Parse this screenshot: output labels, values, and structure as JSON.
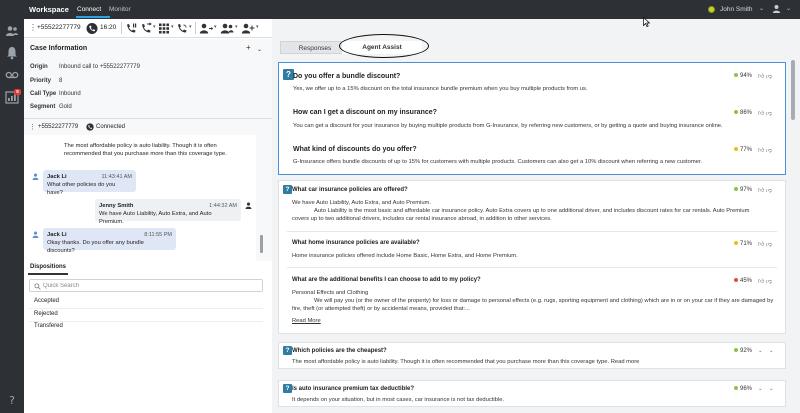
{
  "topbar": {
    "title": "Workspace",
    "tabs": [
      "Connect",
      "Monitor"
    ],
    "user": "John Smith"
  },
  "toolbar": {
    "phone": "+55522277779",
    "timer": "16:20"
  },
  "case_info": {
    "title": "Case Information",
    "fields": [
      {
        "label": "Origin",
        "value": "Inbound call to +55522277779"
      },
      {
        "label": "Priority",
        "value": "8"
      },
      {
        "label": "Call Type",
        "value": "Inbound"
      },
      {
        "label": "Segment",
        "value": "Gold"
      }
    ]
  },
  "call": {
    "number": "+55522277779",
    "status": "Connected"
  },
  "transcript": [
    {
      "text": "The most affordable policy is auto liability. Though it is often recommended that you purchase more than this coverage type."
    },
    {
      "sender": "Jack Li",
      "time": "11:43:41 AM",
      "text": "What other policies do you have?"
    },
    {
      "sender": "Jenny Smith",
      "time": "1:44:32 AM",
      "text": "We have Auto Liability, Auto Extra, and Auto Premium."
    },
    {
      "sender": "Jack Li",
      "time": "8:11:55 PM",
      "text": "Okay thanks. Do you offer any bundle discounts?"
    }
  ],
  "dispositions": {
    "tab": "Dispositions",
    "search_placeholder": "Quick Search",
    "items": [
      "Accepted",
      "Rejected",
      "Transfered"
    ]
  },
  "right_tabs": [
    "Responses",
    "Agent Assist"
  ],
  "featured": [
    {
      "q": "Do you offer a bundle discount?",
      "a": "Yes, we offer up to a 15% discount on the total insurance bundle premium when you buy multiple products from us.",
      "score": "94%",
      "color": "#8bc34a"
    },
    {
      "q": "How can I get a discount on my insurance?",
      "a": "You can get a discount for your insurance by buying multiple products from G-Insurance, by referring new customers, or by getting a quote and buying insurance online.",
      "score": "86%",
      "color": "#8bc34a"
    },
    {
      "q": "What kind of discounts do you offer?",
      "a": "G-Insurance offers bundle discounts of up to 15% for customers with multiple products. Customers can also get a 10% discount when referring a new customer.",
      "score": "77%",
      "color": "#e2c21c"
    }
  ],
  "card2": [
    {
      "q": "What car insurance policies are offered?",
      "a1": "We have Auto Liability, Auto Extra, and Auto Premium.",
      "a2": "Auto Liability is the most basic and affordable car insurance policy. Auto Extra covers up to one additional driver, and includes discount rates for car rentals. Auto Premium",
      "a3": "covers up to two additional drivers, includes car rental insurance abroad, in addition to other services.",
      "score": "97%",
      "color": "#8bc34a"
    },
    {
      "q": "What home insurance policies are available?",
      "a1": "Home insurance policies offered include Home Basic, Home Extra, and Home Premium.",
      "score": "71%",
      "color": "#e2c21c"
    },
    {
      "q": "What are the additional benefits I can choose to add to my policy?",
      "a1": "Personal Effects and Clothing",
      "a2": "We will pay you (or the owner of the property) for loss or damage to personal effects (e.g. rugs, sporting equipment and clothing) which are in or on your car if they are damaged by",
      "a3": "fire, theft (or attempted theft) or by accidental means, provided that:...",
      "link": "Read More",
      "score": "45%",
      "color": "#e74c3c"
    }
  ],
  "card3": {
    "q": "Which policies are the cheapest?",
    "a": "The most affordable policy is auto liability. Though it is often recommended that you purchase more than this coverage type.",
    "link": "Read more",
    "score": "92%",
    "color": "#8bc34a"
  },
  "card4": {
    "q": "Is auto insurance premium tax deductible?",
    "a": "It depends on your situation, but in most cases, car insurance is not tax deductible.",
    "score": "96%",
    "color": "#8bc34a"
  },
  "icons": [
    "contacts-icon",
    "alert-icon",
    "voicemail-icon",
    "reports-icon",
    "help-icon"
  ],
  "badge": "5"
}
